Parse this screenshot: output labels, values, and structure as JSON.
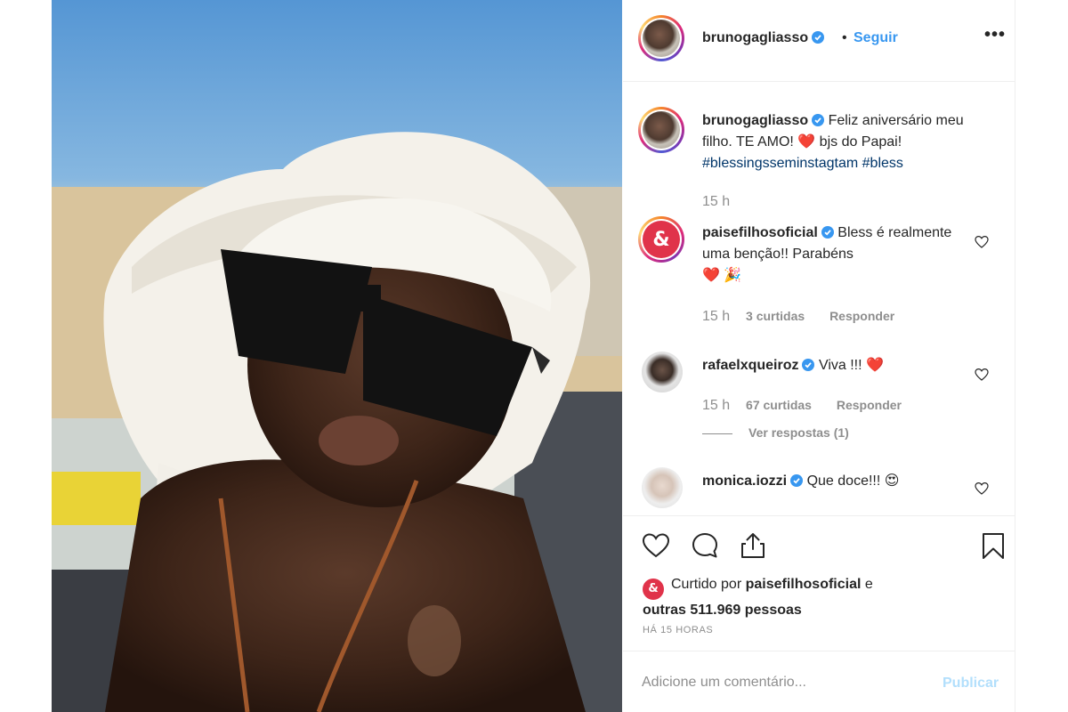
{
  "post": {
    "image_alt": "Child wearing white head wrap and black sunglasses at the beach"
  },
  "header": {
    "username": "brunogagliasso",
    "separator": "•",
    "follow_label": "Seguir",
    "more_label": "•••"
  },
  "caption": {
    "username": "brunogagliasso",
    "text": "Feliz aniversário meu filho. TE AMO! ❤️ bjs do Papai!",
    "hashtags": "#blessingsseminstagtam #bless",
    "time": "15 h"
  },
  "comments": [
    {
      "username": "paisefilhosoficial",
      "text": "Bless é realmente uma benção!! Parabéns",
      "emojis": "❤️ 🎉",
      "time": "15 h",
      "likes": "3 curtidas",
      "reply": "Responder"
    },
    {
      "username": "rafaelxqueiroz",
      "text": "Viva !!! ❤️",
      "time": "15 h",
      "likes": "67 curtidas",
      "reply": "Responder",
      "view_replies": "Ver respostas (1)"
    },
    {
      "username": "monica.iozzi",
      "text": "Que doce!!! 😍"
    }
  ],
  "likes": {
    "prefix": "Curtido por",
    "user": "paisefilhosoficial",
    "middle": "e",
    "others": "outras 511.969 pessoas",
    "brand_mark": "&"
  },
  "timestamp": "HÁ 15 HORAS",
  "add_comment": {
    "placeholder": "Adicione um comentário...",
    "publish_label": "Publicar"
  },
  "colors": {
    "link_blue": "#3897f0",
    "hashtag": "#003569",
    "meta_gray": "#8e8e8e",
    "publish_disabled": "#b2dffc",
    "brand_red": "#e0334a"
  }
}
